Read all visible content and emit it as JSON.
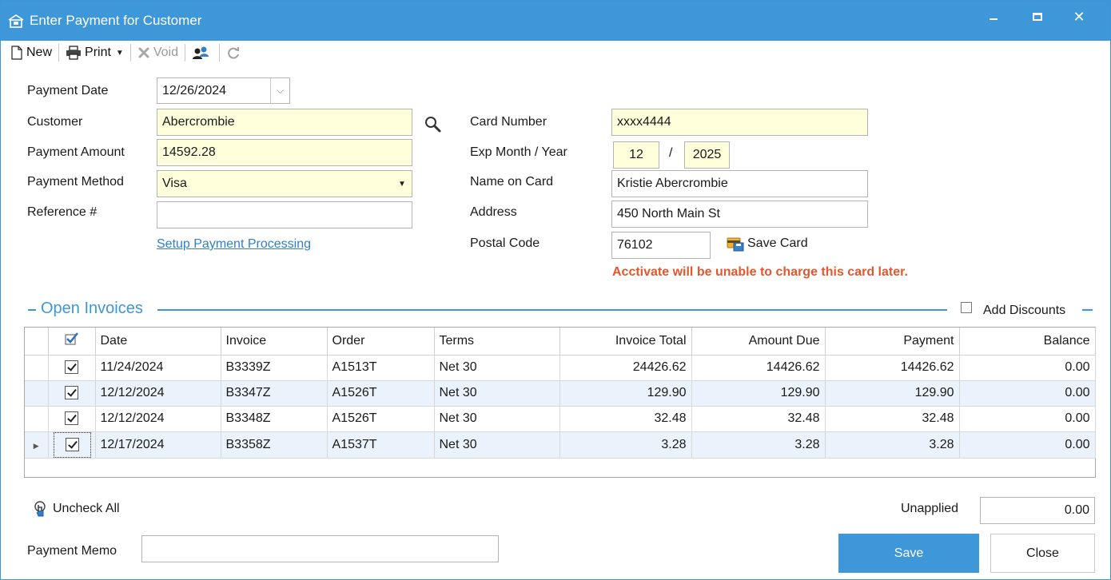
{
  "window": {
    "title": "Enter Payment for Customer"
  },
  "toolbar": {
    "new_label": "New",
    "print_label": "Print",
    "void_label": "Void"
  },
  "form": {
    "payment_date_label": "Payment Date",
    "payment_date_value": "12/26/2024",
    "customer_label": "Customer",
    "customer_value": "Abercrombie",
    "payment_amount_label": "Payment Amount",
    "payment_amount_value": "14592.28",
    "payment_method_label": "Payment Method",
    "payment_method_value": "Visa",
    "reference_label": "Reference #",
    "reference_value": "",
    "setup_link": "Setup Payment Processing",
    "card_number_label": "Card Number",
    "card_number_value": "xxxx4444",
    "exp_label": "Exp Month / Year",
    "exp_month": "12",
    "exp_sep": "/",
    "exp_year": "2025",
    "name_on_card_label": "Name on Card",
    "name_on_card_value": "Kristie Abercrombie",
    "address_label": "Address",
    "address_value": "450 North Main St",
    "postal_code_label": "Postal Code",
    "postal_code_value": "76102",
    "save_card_label": "Save Card",
    "warning": "Acctivate will be unable to charge this card later."
  },
  "invoices": {
    "section_title": "Open Invoices",
    "add_discounts_label": "Add Discounts",
    "columns": [
      "Date",
      "Invoice",
      "Order",
      "Terms",
      "Invoice Total",
      "Amount Due",
      "Payment",
      "Balance"
    ],
    "rows": [
      {
        "date": "11/24/2024",
        "invoice": "B3339Z",
        "order": "A1513T",
        "terms": "Net 30",
        "invoice_total": "24426.62",
        "amount_due": "14426.62",
        "payment": "14426.62",
        "balance": "0.00"
      },
      {
        "date": "12/12/2024",
        "invoice": "B3347Z",
        "order": "A1526T",
        "terms": "Net 30",
        "invoice_total": "129.90",
        "amount_due": "129.90",
        "payment": "129.90",
        "balance": "0.00"
      },
      {
        "date": "12/12/2024",
        "invoice": "B3348Z",
        "order": "A1526T",
        "terms": "Net 30",
        "invoice_total": "32.48",
        "amount_due": "32.48",
        "payment": "32.48",
        "balance": "0.00"
      },
      {
        "date": "12/17/2024",
        "invoice": "B3358Z",
        "order": "A1537T",
        "terms": "Net 30",
        "invoice_total": "3.28",
        "amount_due": "3.28",
        "payment": "3.28",
        "balance": "0.00"
      }
    ]
  },
  "footer": {
    "uncheck_all_label": "Uncheck All",
    "unapplied_label": "Unapplied",
    "unapplied_value": "0.00",
    "memo_label": "Payment Memo",
    "memo_value": "",
    "save_label": "Save",
    "close_label": "Close"
  },
  "colors": {
    "accent": "#3e97d8",
    "required_field": "#ffffdc",
    "warning": "#e4572e",
    "link": "#2f7fc9"
  }
}
